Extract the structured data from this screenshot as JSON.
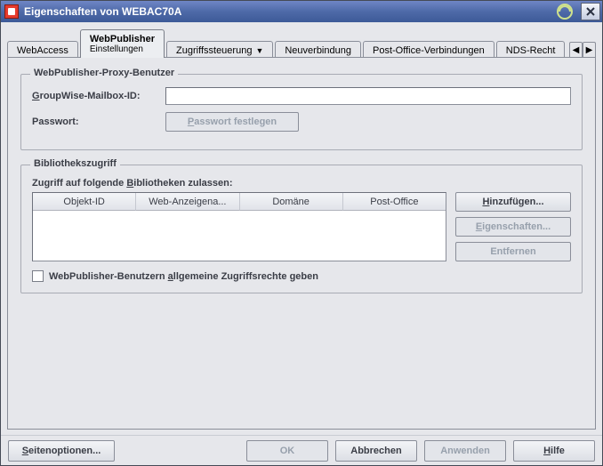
{
  "window": {
    "title": "Eigenschaften von WEBAC70A"
  },
  "tabs": {
    "webaccess": "WebAccess",
    "webpublisher": {
      "label": "WebPublisher",
      "sub": "Einstellungen"
    },
    "zugriff": "Zugriffssteuerung",
    "neuverbindung": "Neuverbindung",
    "postoffice": "Post-Office-Verbindungen",
    "nds": "NDS-Recht"
  },
  "proxy": {
    "legend": "WebPublisher-Proxy-Benutzer",
    "mailbox_pre": "G",
    "mailbox_post": "roupWise-Mailbox-ID:",
    "mailbox_value": "",
    "password_label": "Passwort:",
    "password_btn_pre": "P",
    "password_btn_post": "asswort festlegen"
  },
  "library": {
    "legend": "Bibliothekszugriff",
    "caption_pre": "Zugriff auf folgende ",
    "caption_u": "B",
    "caption_post": "ibliotheken zulassen:",
    "cols": {
      "objektid": "Objekt-ID",
      "webanz": "Web-Anzeigena...",
      "domaene": "Domäne",
      "postoffice": "Post-Office"
    },
    "btn_add_pre": "H",
    "btn_add_post": "inzufügen...",
    "btn_props_pre": "E",
    "btn_props_post": "igenschaften...",
    "btn_remove_label": "Entfernen",
    "chk_pre": "WebPublisher-Benutzern ",
    "chk_u": "a",
    "chk_post": "llgemeine Zugriffsrechte geben"
  },
  "buttons": {
    "pageopts_pre": "S",
    "pageopts_post": "eitenoptionen...",
    "ok": "OK",
    "cancel": "Abbrechen",
    "apply": "Anwenden",
    "help_pre": "H",
    "help_post": "ilfe"
  }
}
